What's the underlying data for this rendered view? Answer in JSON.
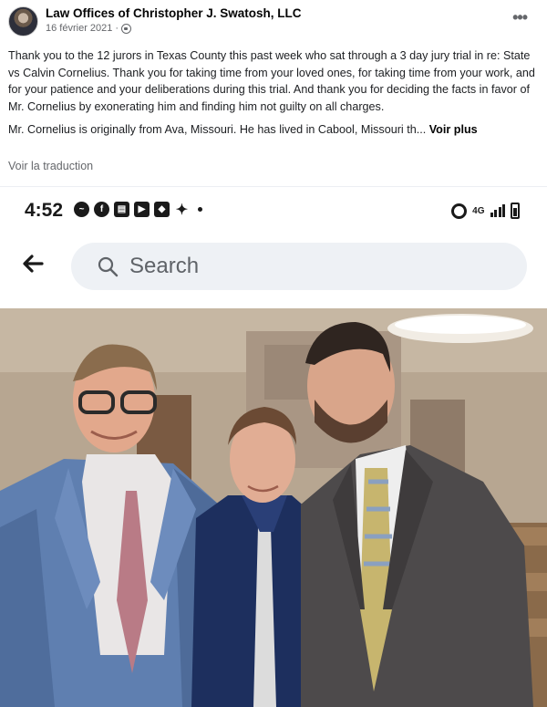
{
  "post": {
    "author": "Law Offices of Christopher J. Swatosh, LLC",
    "date": "16 février 2021 ·",
    "more_icon": "more-horizontal-icon",
    "paragraph_1": "Thank you to the 12 jurors in Texas County this past week who sat through a 3 day jury trial in re: State vs Calvin Cornelius. Thank you for taking time from your loved ones, for taking time from your work, and for your patience and your deliberations during this trial. And thank you for deciding the facts in favor of Mr. Cornelius by exonerating him and finding him not guilty on all charges.",
    "paragraph_2": "Mr. Cornelius is originally from Ava, Missouri. He has lived in Cabool, Missouri th...",
    "see_more": "Voir plus",
    "translate": "Voir la traduction"
  },
  "phone": {
    "time": "4:52",
    "network": "4G",
    "search_placeholder": "Search"
  },
  "colors": {
    "text": "#1c1e21",
    "meta": "#65676b",
    "search_bg": "#eef1f5"
  }
}
